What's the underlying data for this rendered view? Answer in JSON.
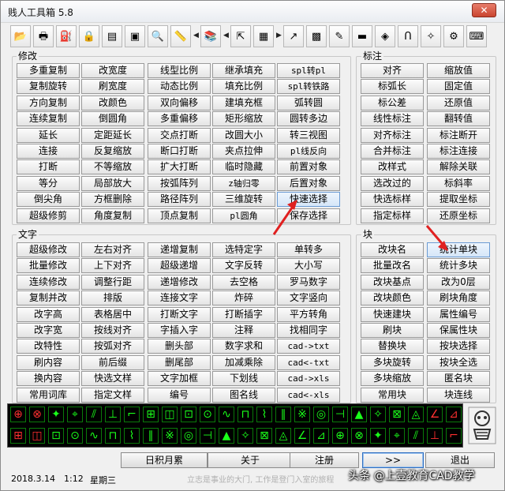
{
  "window": {
    "title": "贱人工具箱 5.8",
    "close_label": "✕"
  },
  "toolbar": [
    {
      "icon": "open-folder-icon",
      "glyph": "📂"
    },
    {
      "icon": "print-icon",
      "glyph": "🖶"
    },
    {
      "icon": "stamp-icon",
      "glyph": "⛽"
    },
    {
      "icon": "lock-icon",
      "glyph": "🔒"
    },
    {
      "icon": "film-icon",
      "glyph": "▤"
    },
    {
      "icon": "window-icon",
      "glyph": "▣"
    },
    {
      "icon": "zoom-icon",
      "glyph": "🔍"
    },
    {
      "icon": "ruler-icon",
      "glyph": "📏"
    },
    {
      "icon": "arrow-left-icon",
      "glyph": "◀"
    },
    {
      "icon": "books-icon",
      "glyph": "📚"
    },
    {
      "icon": "arrow-left-icon",
      "glyph": "◀"
    },
    {
      "icon": "align-icon",
      "glyph": "⇱"
    },
    {
      "icon": "text-block-icon",
      "glyph": "▦"
    },
    {
      "icon": "arrow-right-icon",
      "glyph": "▶"
    },
    {
      "icon": "jump-icon",
      "glyph": "↗"
    },
    {
      "icon": "palette-icon",
      "glyph": "▩"
    },
    {
      "icon": "edit-icon",
      "glyph": "✎"
    },
    {
      "icon": "calculator-icon",
      "glyph": "▬"
    },
    {
      "icon": "eraser-icon",
      "glyph": "◈"
    },
    {
      "icon": "magnet-icon",
      "glyph": "Ո"
    },
    {
      "icon": "target-icon",
      "glyph": "✧"
    },
    {
      "icon": "gear-icon",
      "glyph": "⚙"
    },
    {
      "icon": "keyboard-icon",
      "glyph": "⌨"
    }
  ],
  "groups": {
    "modify_title": "修改",
    "annotate_title": "标注",
    "text_title": "文字",
    "block_title": "块"
  },
  "modify_buttons": [
    [
      "多重复制",
      "改宽度",
      "线型比例",
      "继承填充",
      "spl转pl"
    ],
    [
      "复制旋转",
      "刷宽度",
      "动态比例",
      "填充比例",
      "spl转铁路"
    ],
    [
      "方向复制",
      "改颜色",
      "双向偏移",
      "建填充框",
      "弧转圆"
    ],
    [
      "连续复制",
      "倒圆角",
      "多重偏移",
      "矩形缩放",
      "圆转多边"
    ],
    [
      "延长",
      "定距延长",
      "交点打断",
      "改圆大小",
      "转三视图"
    ],
    [
      "连接",
      "反复缩放",
      "断口打断",
      "夹点拉伸",
      "pl线反向"
    ],
    [
      "打断",
      "不等缩放",
      "扩大打断",
      "临时隐藏",
      "前置对象"
    ],
    [
      "等分",
      "局部放大",
      "按弧阵列",
      "z轴归零",
      "后置对象"
    ],
    [
      "倒尖角",
      "方框删除",
      "路径阵列",
      "三维旋转",
      "快速选择"
    ],
    [
      "超级修剪",
      "角度复制",
      "顶点复制",
      "pl圆角",
      "保存选择"
    ]
  ],
  "annotate_buttons": [
    [
      "对齐",
      "缩放值"
    ],
    [
      "标弧长",
      "固定值"
    ],
    [
      "标公差",
      "还原值"
    ],
    [
      "线性标注",
      "翻转值"
    ],
    [
      "对齐标注",
      "标注断开"
    ],
    [
      "合并标注",
      "标注连接"
    ],
    [
      "改样式",
      "解除关联"
    ],
    [
      "选改过的",
      "标斜率"
    ],
    [
      "快选标样",
      "提取坐标"
    ],
    [
      "指定标样",
      "还原坐标"
    ]
  ],
  "text_buttons": [
    [
      "超级修改",
      "左右对齐",
      "递增复制",
      "选特定字",
      "单转多"
    ],
    [
      "批量修改",
      "上下对齐",
      "超级递增",
      "文字反转",
      "大小写"
    ],
    [
      "连续修改",
      "调整行距",
      "递增修改",
      "去空格",
      "罗马数字"
    ],
    [
      "复制并改",
      "排版",
      "连接文字",
      "炸碎",
      "文字竖向"
    ],
    [
      "改字高",
      "表格居中",
      "打断文字",
      "打断插字",
      "平方转角"
    ],
    [
      "改字宽",
      "按线对齐",
      "字插入字",
      "注释",
      "找相同字"
    ],
    [
      "改特性",
      "按弧对齐",
      "删头部",
      "数字求和",
      "cad->txt"
    ],
    [
      "刷内容",
      "前后缀",
      "删尾部",
      "加减乘除",
      "cad<-txt"
    ],
    [
      "换内容",
      "快选文样",
      "文字加框",
      "下划线",
      "cad->xls"
    ],
    [
      "常用词库",
      "指定文样",
      "编号",
      "图名线",
      "cad<-xls"
    ]
  ],
  "block_buttons": [
    [
      "改块名",
      "统计单块"
    ],
    [
      "批量改名",
      "统计多块"
    ],
    [
      "改块基点",
      "改为0层"
    ],
    [
      "改块颜色",
      "刷块角度"
    ],
    [
      "快速建块",
      "属性编号"
    ],
    [
      "刷块",
      "保属性块"
    ],
    [
      "替换块",
      "按块选择"
    ],
    [
      "多块旋转",
      "按块全选"
    ],
    [
      "多块缩放",
      "匿名块"
    ],
    [
      "常用块",
      "块连线"
    ]
  ],
  "bottom_buttons": {
    "accumulate": "日积月累",
    "about": "关于",
    "register": "注册",
    "next": ">>",
    "exit": "退出"
  },
  "status": {
    "date": "2018.3.14",
    "time": "1:12",
    "weekday": "星期三",
    "motto": "立志是事业的大门, 工作是登门入室的旅程",
    "watermark": "头条 @上壹教育CAD教学"
  },
  "colors": {
    "strip_bg": "#000000",
    "glyph": "#1aff1a",
    "glyph_red": "#ff3030"
  }
}
